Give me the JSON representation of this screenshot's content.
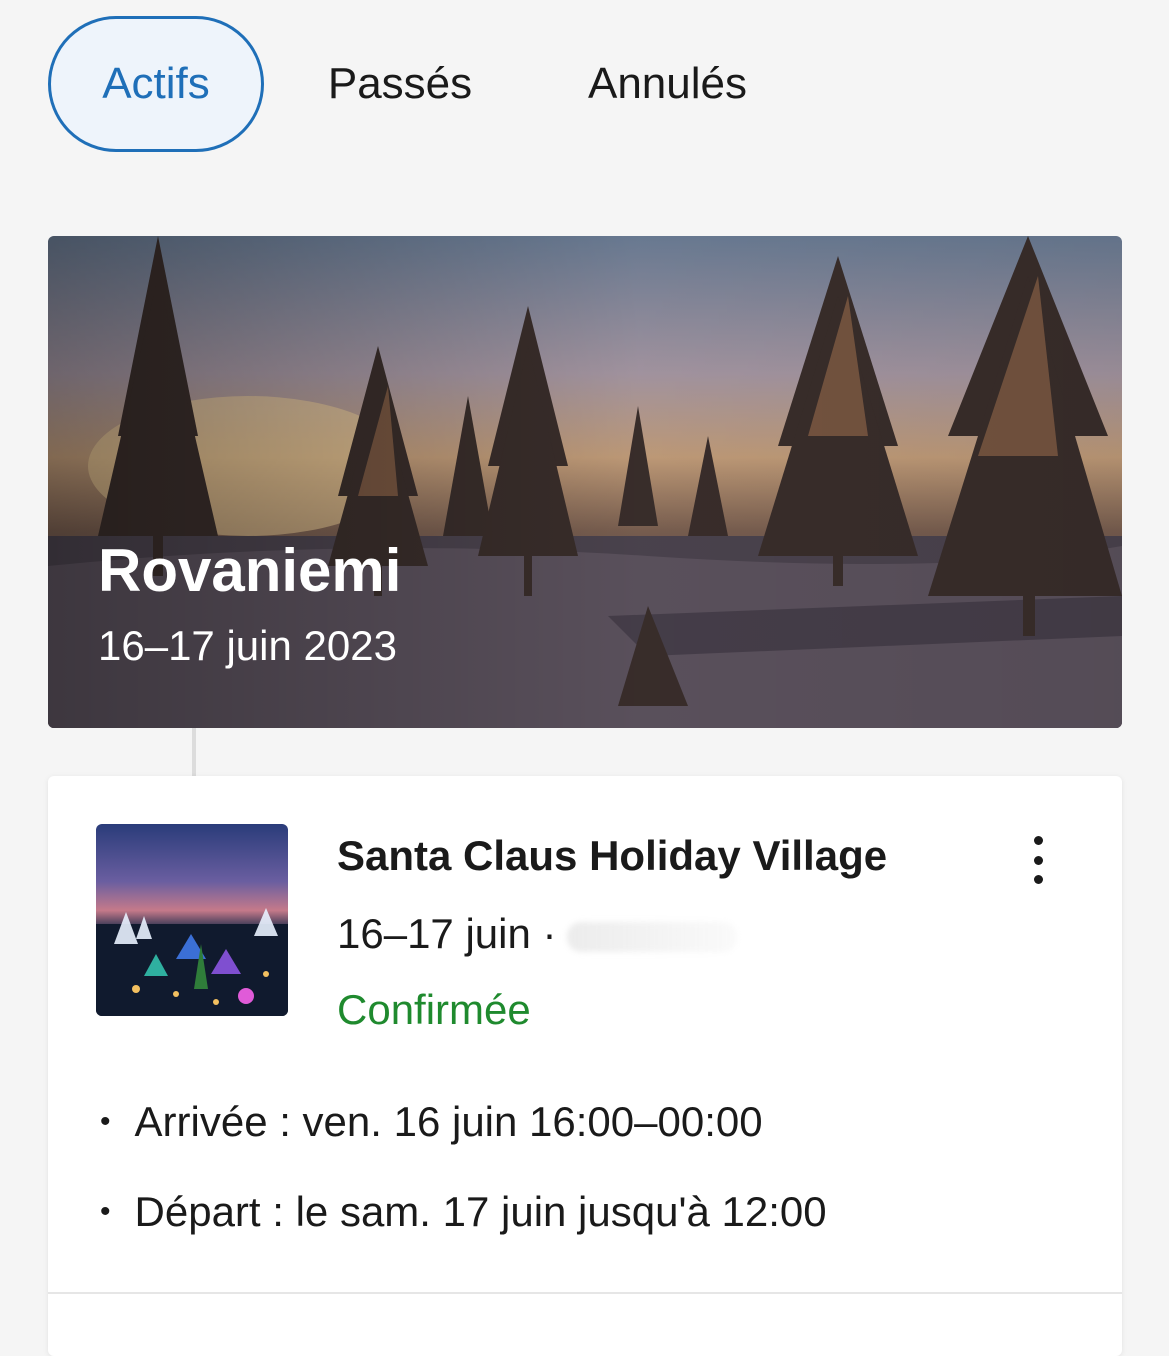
{
  "tabs": [
    {
      "label": "Actifs",
      "active": true
    },
    {
      "label": "Passés",
      "active": false
    },
    {
      "label": "Annulés",
      "active": false
    }
  ],
  "trip": {
    "city": "Rovaniemi",
    "dates": "16–17 juin 2023"
  },
  "booking": {
    "hotel_name": "Santa Claus Holiday Village",
    "dates": "16–17 juin ·",
    "status": "Confirmée",
    "checkin": "Arrivée : ven. 16 juin 16:00–00:00",
    "checkout": "Départ : le sam. 17 juin jusqu'à 12:00"
  },
  "icons": {
    "more": "more-vertical-icon"
  },
  "colors": {
    "accent": "#1f6fb8",
    "status_confirmed": "#1f8a2e"
  }
}
